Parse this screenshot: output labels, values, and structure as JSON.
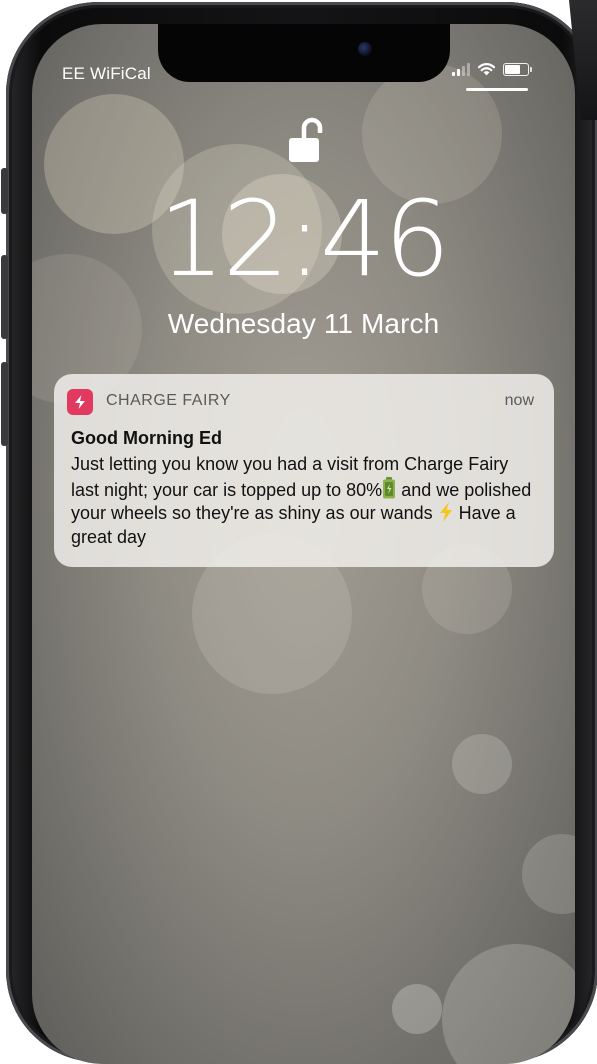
{
  "status_bar": {
    "carrier": "EE WiFiCal"
  },
  "lock_screen": {
    "time": "12:46",
    "date": "Wednesday 11 March",
    "lock_icon": "unlocked-padlock-icon"
  },
  "notification": {
    "app_icon": "lightning-bolt-icon",
    "app_name": "CHARGE FAIRY",
    "timestamp": "now",
    "title": "Good Morning Ed",
    "body_part1": "Just letting you know you had a visit from Charge Fairy last night; your car is topped up to 80%",
    "body_part2": "and we polished your wheels so they're as shiny as our wands",
    "body_part3": "Have a great day",
    "emoji_battery": "battery-emoji",
    "emoji_bolt": "lightning-emoji"
  },
  "colors": {
    "app_icon_bg": "#e1395f",
    "notification_bg": "#f0eeea",
    "wallpaper": "#8e8b83"
  }
}
